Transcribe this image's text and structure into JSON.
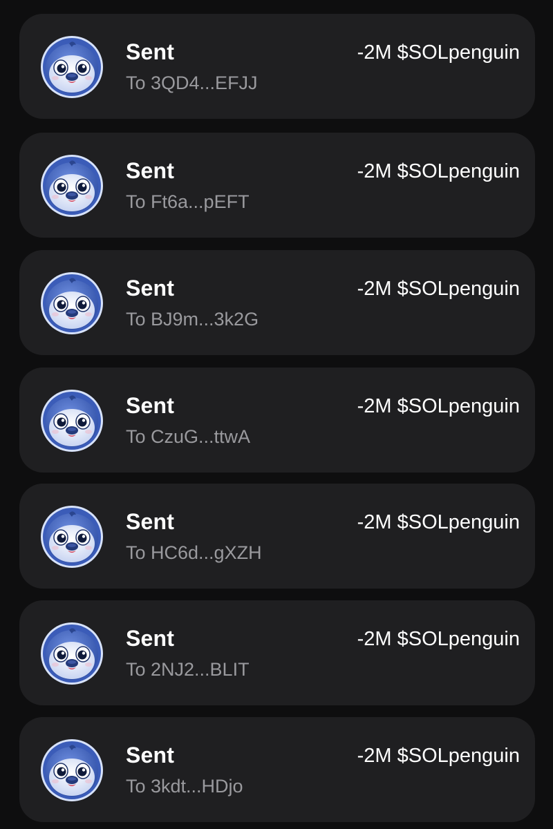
{
  "transactions": [
    {
      "title": "Sent",
      "recipient": "To 3QD4...EFJJ",
      "amount": "-2M $SOLpenguin"
    },
    {
      "title": "Sent",
      "recipient": "To Ft6a...pEFT",
      "amount": "-2M $SOLpenguin"
    },
    {
      "title": "Sent",
      "recipient": "To BJ9m...3k2G",
      "amount": "-2M $SOLpenguin"
    },
    {
      "title": "Sent",
      "recipient": "To CzuG...ttwA",
      "amount": "-2M $SOLpenguin"
    },
    {
      "title": "Sent",
      "recipient": "To HC6d...gXZH",
      "amount": "-2M $SOLpenguin"
    },
    {
      "title": "Sent",
      "recipient": "To 2NJ2...BLIT",
      "amount": "-2M $SOLpenguin"
    },
    {
      "title": "Sent",
      "recipient": "To 3kdt...HDjo",
      "amount": "-2M $SOLpenguin"
    }
  ],
  "avatar_icon": "penguin-token-icon",
  "colors": {
    "background": "#0e0e0f",
    "card": "#1f1f21",
    "title": "#ffffff",
    "subtitle": "#9a9a9e",
    "amount": "#ffffff"
  }
}
